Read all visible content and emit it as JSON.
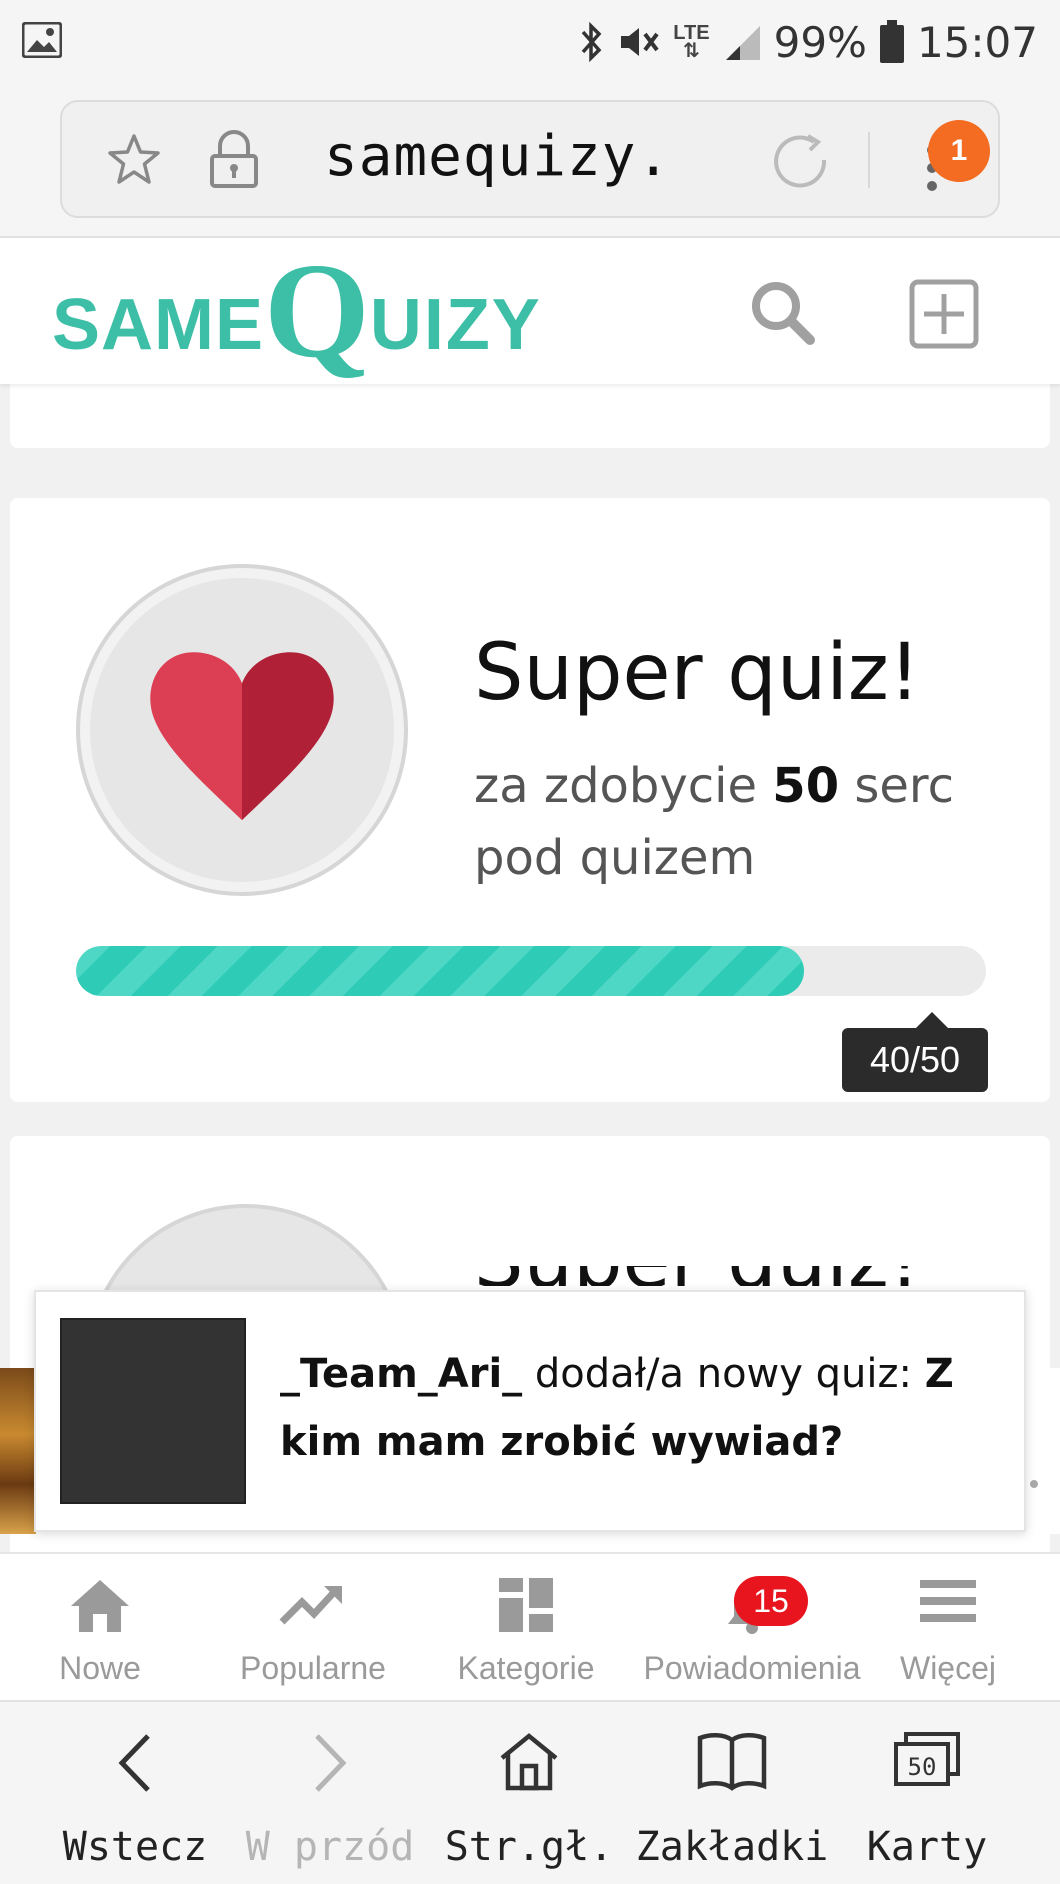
{
  "status_bar": {
    "battery": "99%",
    "time": "15:07",
    "network": "LTE"
  },
  "url_bar": {
    "url": "samequizy.",
    "menu_badge": "1"
  },
  "header": {
    "logo_same": "SAME",
    "logo_q": "Q",
    "logo_uizy": "UIZY"
  },
  "achievement": {
    "title": "Super quiz!",
    "desc_prefix": "za zdobycie ",
    "desc_count": "50",
    "desc_suffix": " serc pod quizem",
    "progress_label": "40/50",
    "progress_value": 0.8
  },
  "next_card": {
    "title": "Super quiz!"
  },
  "notification": {
    "user": "_Team_Ari_",
    "action": " dodał/a nowy quiz: ",
    "quiz_title": "Z kim mam zrobić wywiad?"
  },
  "app_nav": {
    "items": [
      {
        "label": "Nowe",
        "icon": "home-icon"
      },
      {
        "label": "Popularne",
        "icon": "trending-icon"
      },
      {
        "label": "Kategorie",
        "icon": "categories-icon"
      },
      {
        "label": "Powiadomienia",
        "icon": "bell-icon"
      },
      {
        "label": "Więcej",
        "icon": "menu-icon"
      }
    ],
    "notifications_count": "15"
  },
  "browser_nav": {
    "items": [
      {
        "label": "Wstecz",
        "icon": "back-icon"
      },
      {
        "label": "W przód",
        "icon": "forward-icon"
      },
      {
        "label": "Str.gł.",
        "icon": "home-icon"
      },
      {
        "label": "Zakładki",
        "icon": "bookmarks-icon"
      },
      {
        "label": "Karty",
        "icon": "tabs-icon"
      }
    ],
    "tabs_count": "50"
  },
  "colors": {
    "accent": "#3dbea6",
    "progress": "#2ecbb7",
    "badge": "#f36c21",
    "notification_badge": "#e8141e",
    "heart_light": "#dc3e53",
    "heart_dark": "#b02138"
  }
}
